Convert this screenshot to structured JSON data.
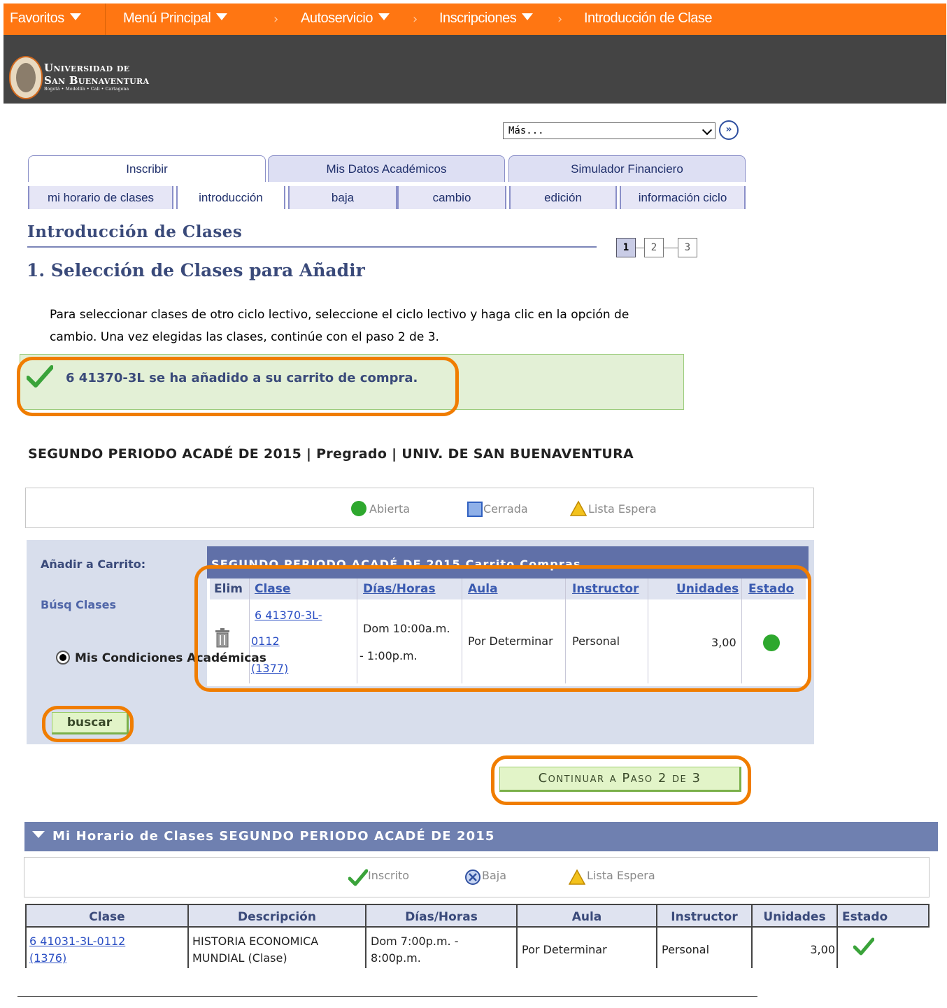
{
  "topnav": {
    "favoritos": "Favoritos",
    "menu_principal": "Menú Principal",
    "autoservicio": "Autoservicio",
    "inscripciones": "Inscripciones",
    "introduccion": "Introducción de Clase",
    "brand_color": "#ff7612"
  },
  "logo": {
    "line1": "Universidad de",
    "line2": "San Buenaventura",
    "line3": "Bogotá • Medellín • Cali • Cartagena"
  },
  "mas": {
    "value": "Más...",
    "go_glyph": "»"
  },
  "tabs": [
    {
      "label": "Inscribir",
      "active": true
    },
    {
      "label": "Mis Datos Académicos",
      "active": false
    },
    {
      "label": "Simulador Financiero",
      "active": false
    }
  ],
  "subtabs": [
    {
      "label": "mi horario de clases"
    },
    {
      "label": "introducción"
    },
    {
      "label": "baja"
    },
    {
      "label": "cambio"
    },
    {
      "label": "edición"
    },
    {
      "label": "información ciclo"
    }
  ],
  "page_title": "Introducción de Clases",
  "steps": [
    "1",
    "2",
    "3"
  ],
  "subtitle": "1. Selección de Clases para Añadir",
  "intro_text": "Para seleccionar clases de otro ciclo lectivo, seleccione el ciclo lectivo y haga clic en la opción de cambio. Una vez elegidas las clases, continúe con el paso 2 de 3.",
  "success_message": "6 41370-3L se ha añadido a su carrito de compra.",
  "term_line": "SEGUNDO PERIODO ACADÉ DE 2015 | Pregrado | UNIV. DE SAN BUENAVENTURA",
  "legend_top": {
    "abierta": "Abierta",
    "cerrada": "Cerrada",
    "lista_espera": "Lista Espera"
  },
  "cart": {
    "add_label": "Añadir a Carrito:",
    "busq_label": "Búsq Clases",
    "radio_label": "Mis Condiciones Académicas",
    "buscar": "buscar",
    "panel_title": "SEGUNDO PERIODO ACADÉ DE 2015 Carrito Compras",
    "headers": {
      "elim": "Elim",
      "clase": "Clase",
      "dias": "Días/Horas",
      "aula": "Aula",
      "instructor": "Instructor",
      "unidades": "Unidades",
      "estado": "Estado"
    },
    "row": {
      "clase_l1": "6 41370-3L-",
      "clase_l2": "0112",
      "clase_l3": "(1377)",
      "dias_l1": "Dom 10:00a.m.",
      "dias_l2": "- 1:00p.m.",
      "aula": "Por Determinar",
      "instructor": "Personal",
      "unidades": "3,00",
      "estado_color": "#2ea82e"
    }
  },
  "continuar": "Continuar a Paso 2 de 3",
  "schedule": {
    "title": "Mi Horario de Clases SEGUNDO PERIODO ACADÉ DE 2015",
    "legend": {
      "inscrito": "Inscrito",
      "baja": "Baja",
      "lista_espera": "Lista Espera"
    },
    "headers": {
      "clase": "Clase",
      "descripcion": "Descripción",
      "dias": "Días/Horas",
      "aula": "Aula",
      "instructor": "Instructor",
      "unidades": "Unidades",
      "estado": "Estado"
    },
    "row": {
      "clase_l1": "6 41031-3L-0112",
      "clase_l2": "(1376)",
      "desc_l1": "HISTORIA ECONOMICA",
      "desc_l2": "MUNDIAL (Clase)",
      "dias_l1": "Dom 7:00p.m. -",
      "dias_l2": "8:00p.m.",
      "aula": "Por Determinar",
      "instructor": "Personal",
      "unidades": "3,00"
    }
  },
  "highlight_color": "#f07d00"
}
